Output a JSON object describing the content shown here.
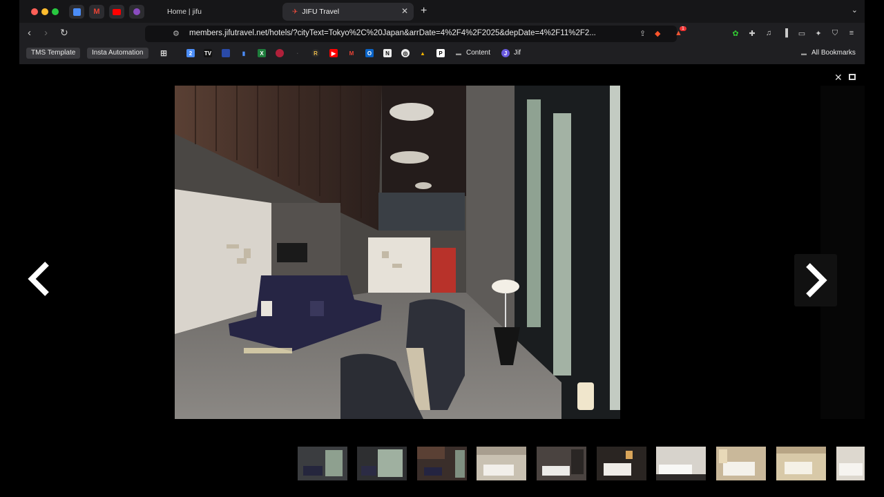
{
  "browser": {
    "tabs": [
      {
        "label": "Home | jifu"
      },
      {
        "label": "JIFU Travel"
      }
    ],
    "pinned_icons": [
      "calendar-icon",
      "gmail-icon",
      "youtube-icon",
      "extension-icon"
    ],
    "url": "members.jifutravel.net/hotels/?cityText=Tokyo%2C%20Japan&arrDate=4%2F4%2F2025&depDate=4%2F11%2F2...",
    "notification_count": "1",
    "bookmarks": {
      "tms_template": "TMS Template",
      "insta_automation": "Insta Automation",
      "content": "Content",
      "jif": "Jif",
      "all_bookmarks": "All Bookmarks"
    }
  },
  "gallery": {
    "thumbnail_count": 10,
    "colors": {
      "background": "#000000",
      "arrow": "#ffffff"
    }
  }
}
